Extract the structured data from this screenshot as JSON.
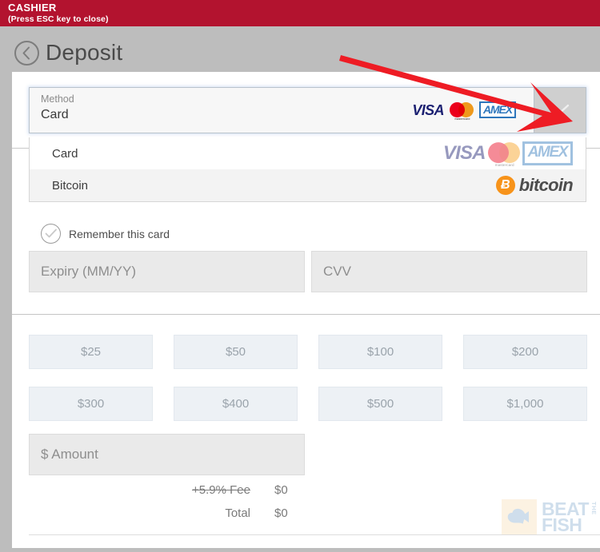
{
  "cashier": {
    "title": "CASHIER",
    "subtitle": "(Press ESC key to close)"
  },
  "header": {
    "back_icon": "chevron-left-circle-icon",
    "page_title": "Deposit"
  },
  "method_select": {
    "label": "Method",
    "value": "Card",
    "caret_icon": "chevron-down-icon",
    "logos": [
      "VISA",
      "mastercard",
      "AMEX"
    ]
  },
  "dropdown": {
    "open": true,
    "options": [
      {
        "label": "Card",
        "logos": [
          "VISA",
          "mastercard",
          "AMEX"
        ]
      },
      {
        "label": "Bitcoin",
        "logos": [
          "bitcoin"
        ]
      }
    ]
  },
  "brands": {
    "visa": "VISA",
    "mastercard_text": "mastercard",
    "amex": "AMEX",
    "bitcoin_symbol": "Ƀ",
    "bitcoin_word": "bitcoin"
  },
  "remember": {
    "label": "Remember this card",
    "checked": true,
    "icon": "check-icon"
  },
  "card_fields": {
    "expiry_placeholder": "Expiry (MM/YY)",
    "expiry_value": "",
    "cvv_placeholder": "CVV",
    "cvv_value": ""
  },
  "presets": [
    {
      "label": "$25"
    },
    {
      "label": "$50"
    },
    {
      "label": "$100"
    },
    {
      "label": "$200"
    },
    {
      "label": "$300"
    },
    {
      "label": "$400"
    },
    {
      "label": "$500"
    },
    {
      "label": "$1,000"
    }
  ],
  "amount": {
    "placeholder": "$ Amount",
    "value": ""
  },
  "totals": {
    "fee_label": "+5.9% Fee",
    "fee_value": "$0",
    "total_label": "Total",
    "total_value": "$0"
  },
  "watermark": {
    "beat": "BEAT",
    "the": "THE",
    "fish": "FISH"
  },
  "annotation": {
    "arrow": "red-arrow-pointing-to-method-dropdown-caret"
  },
  "colors": {
    "cashier_red": "#b3132f",
    "page_gray": "#bdbdbd",
    "visa_blue": "#1a1f71",
    "amex_blue": "#2e77bc",
    "mastercard_red": "#eb001b",
    "mastercard_yellow": "#f79e1b",
    "bitcoin_orange": "#f7931a",
    "annotation_red": "#ee1c24"
  }
}
